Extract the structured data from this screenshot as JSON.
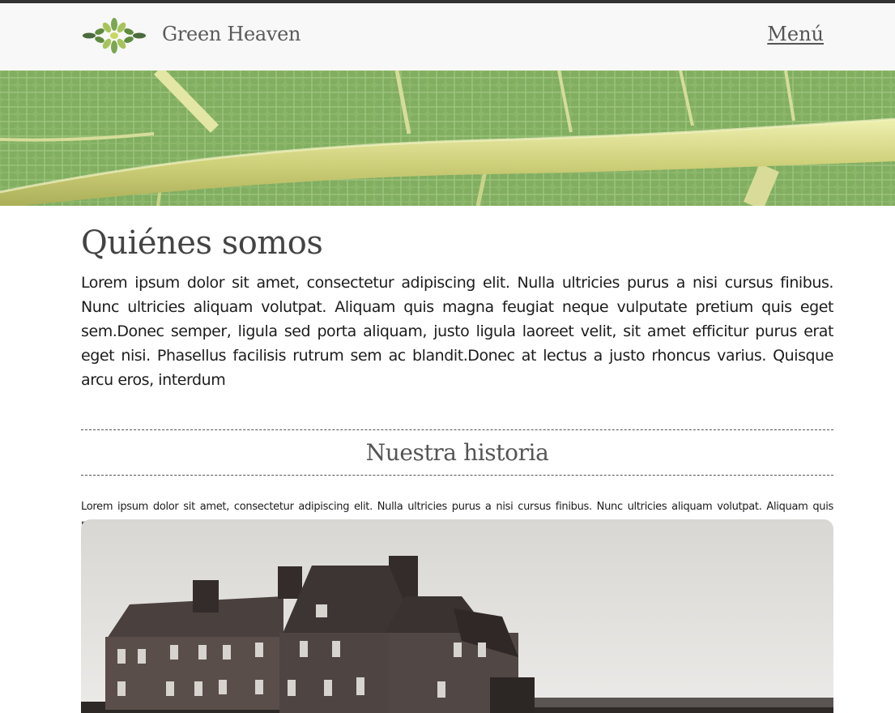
{
  "header": {
    "brand": "Green Heaven",
    "menu_label": "Menú",
    "logo_icon": "leaf-cluster-logo"
  },
  "about": {
    "title": "Quiénes somos",
    "body": "Lorem ipsum dolor sit amet, consectetur adipiscing elit. Nulla ultricies purus a nisi cursus finibus. Nunc ultricies aliquam volutpat. Aliquam quis magna feugiat neque vulputate pretium quis eget sem.Donec semper, ligula sed porta aliquam, justo ligula laoreet velit, sit amet efficitur purus erat eget nisi. Phasellus facilisis rutrum sem ac blandit.Donec at lectus a justo rhoncus varius. Quisque arcu eros, interdum"
  },
  "history": {
    "title": "Nuestra historia",
    "body": "Lorem ipsum dolor sit amet, consectetur adipiscing elit. Nulla ultricies purus a nisi cursus finibus. Nunc ultricies aliquam volutpat. Aliquam quis magna feugiat neque vulputate pretium quis eget sem.Donec semper,"
  },
  "colors": {
    "header_bg": "#f8f8f8",
    "leaf_green": "#8cb56a",
    "leaf_vein": "#d8d890",
    "text_dark": "#444444"
  }
}
